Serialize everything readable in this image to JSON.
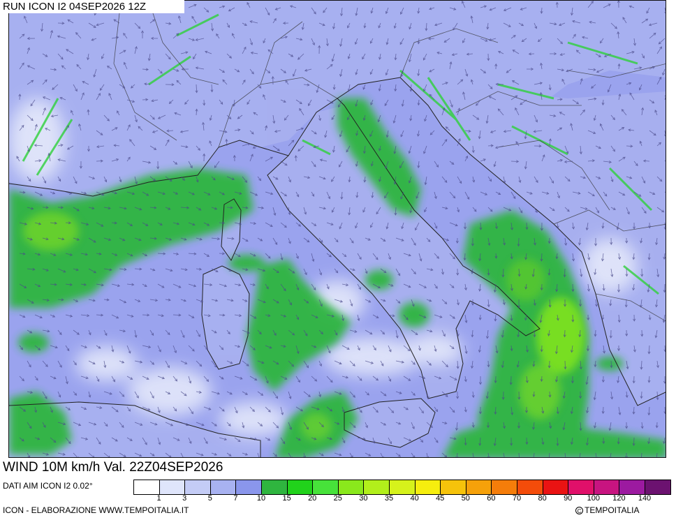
{
  "header": {
    "run_title": "RUN ICON I2 04SEP2026 12Z"
  },
  "footer": {
    "valid_title": "WIND 10M km/h Val. 22Z04SEP2026",
    "data_source": "DATI AIM ICON I2 0.02°",
    "credits": "ICON - ELABORAZIONE WWW.TEMPOITALIA.IT",
    "copyright": "TEMPOITALIA",
    "copyright_symbol": "C"
  },
  "legend": {
    "unit": "km/h",
    "labels": [
      "1",
      "3",
      "5",
      "7",
      "10",
      "15",
      "20",
      "25",
      "30",
      "35",
      "40",
      "45",
      "50",
      "60",
      "70",
      "80",
      "90",
      "100",
      "120",
      "140"
    ],
    "colors": [
      "#ffffff",
      "#dfe5fb",
      "#c4ccf6",
      "#a8b2f1",
      "#8a96ec",
      "#2fb53f",
      "#21d21b",
      "#47e23a",
      "#8ae81c",
      "#b2ef1b",
      "#d6f21b",
      "#f6ee0e",
      "#f6c30b",
      "#f6a10a",
      "#f57d0a",
      "#f44c0a",
      "#ea1313",
      "#e0106a",
      "#c81480",
      "#9c1aa0",
      "#6c1270"
    ]
  },
  "map": {
    "variable": "wind-10m",
    "ocean_color": "#9aa3ee",
    "land_color": "#a8b0ee",
    "wind_colors": {
      "calm": "#e8ecfb",
      "light": "#c4ccf6",
      "moderate": "#2fb53f",
      "fresh": "#47e23a",
      "strong": "#8ae81c",
      "gale": "#b2ef1b"
    },
    "arrow_color": "#4a4a8a"
  }
}
